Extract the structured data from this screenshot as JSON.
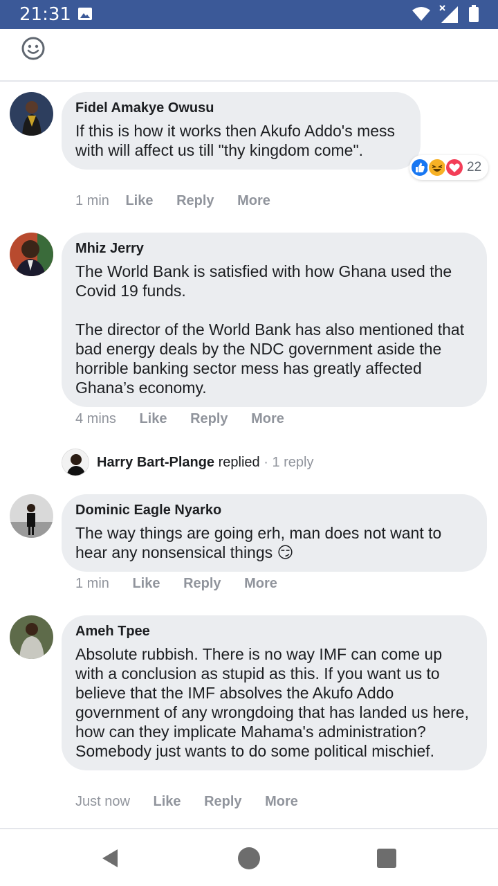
{
  "status_bar": {
    "time": "21:31",
    "icons": [
      "image-icon",
      "wifi-icon",
      "signal-icon",
      "battery-icon"
    ]
  },
  "toolbar": {
    "icon": "emoji-icon"
  },
  "comments": [
    {
      "author": "Fidel Amakye Owusu",
      "text": "If this is how it works then Akufo Addo's mess with will affect us till \"thy kingdom come\".",
      "time": "1 min",
      "like": "Like",
      "reply": "Reply",
      "more": "More",
      "reactions": {
        "types": [
          "like",
          "haha",
          "love"
        ],
        "count": "22",
        "colors": [
          "#1877f2",
          "#f7b125",
          "#f33e58"
        ]
      }
    },
    {
      "author": "Mhiz Jerry",
      "text": "The World Bank is satisfied with how Ghana used the Covid 19 funds.\n\nThe director of the World Bank has also mentioned that bad energy deals by the NDC government aside the horrible banking sector mess has greatly affected Ghana’s economy.",
      "time": "4 mins",
      "like": "Like",
      "reply": "Reply",
      "more": "More",
      "replies": {
        "name": "Harry Bart-Plange",
        "verb": "replied",
        "sep": "·",
        "count": "1 reply"
      }
    },
    {
      "author": "Dominic Eagle Nyarko",
      "text": "The way things are going erh, man does not want to hear any nonsensical things 😏",
      "time": "1 min",
      "like": "Like",
      "reply": "Reply",
      "more": "More"
    },
    {
      "author": "Ameh Tpee",
      "text": "Absolute rubbish. There is no way IMF can come up with a conclusion as stupid as this. If you want us to believe that the IMF absolves the Akufo Addo government of any wrongdoing that has landed us here, how can they implicate Mahama's administration? Somebody just wants to do some political mischief.",
      "time": "Just now",
      "like": "Like",
      "reply": "Reply",
      "more": "More"
    }
  ],
  "nav": {
    "icons": [
      "back-icon",
      "home-icon",
      "recents-icon"
    ]
  },
  "colors": {
    "status_bar": "#3b5998",
    "bubble": "#ebedf0",
    "meta_text": "#90949c"
  }
}
